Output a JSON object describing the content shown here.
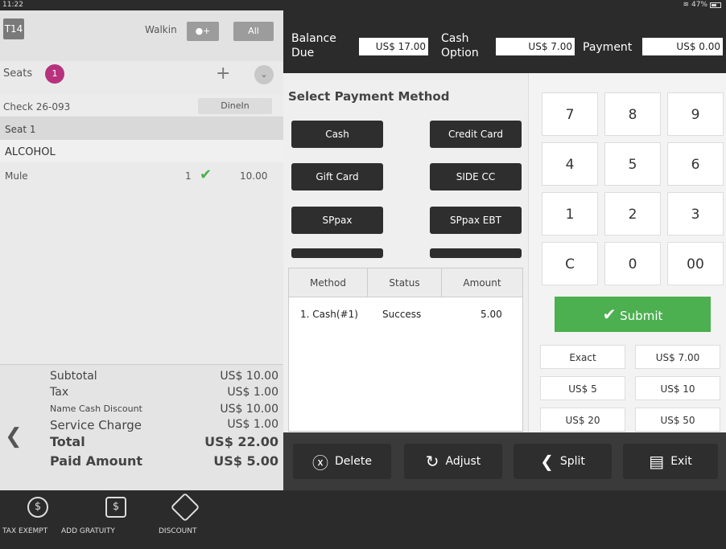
{
  "status_bar": {
    "time": "11:22",
    "battery": "47%"
  },
  "left": {
    "table": "T14",
    "walkin": "Walkin",
    "filter_all": "All",
    "seats_label": "Seats",
    "seats_count": "1",
    "check": "Check 26-093",
    "order_type": "DineIn",
    "seat": "Seat 1",
    "category": "ALCOHOL",
    "item": {
      "name": "Mule",
      "qty": "1",
      "price": "10.00"
    },
    "totals": [
      {
        "label": "Subtotal",
        "value": "US$ 10.00"
      },
      {
        "label": "Tax",
        "value": "US$ 1.00"
      },
      {
        "label": "Name Cash Discount",
        "value": "US$ 10.00"
      },
      {
        "label": "Service Charge",
        "value": "US$ 1.00"
      },
      {
        "label": "Total",
        "value": "US$ 22.00"
      },
      {
        "label": "Paid Amount",
        "value": "US$ 5.00"
      }
    ]
  },
  "bottom_bar": {
    "tax_exempt": "TAX EXEMPT",
    "add_gratuity": "ADD GRATUITY",
    "discount": "DISCOUNT"
  },
  "top": {
    "balance_due_label_1": "Balance",
    "balance_due_label_2": "Due",
    "balance_due": "US$ 17.00",
    "cash_option_label_1": "Cash",
    "cash_option_label_2": "Option",
    "cash_option": "US$ 7.00",
    "payment_label": "Payment",
    "payment": "US$ 0.00"
  },
  "payment_methods": {
    "title": "Select Payment Method",
    "buttons": [
      "Cash",
      "Credit Card",
      "Gift Card",
      "SIDE CC",
      "SPpax",
      "SPpax EBT"
    ],
    "table_headers": [
      "Method",
      "Status",
      "Amount"
    ],
    "rows": [
      {
        "method": "1. Cash(#1)",
        "status": "Success",
        "amount": "5.00"
      }
    ]
  },
  "keypad": {
    "keys": [
      "7",
      "8",
      "9",
      "4",
      "5",
      "6",
      "1",
      "2",
      "3",
      "C",
      "0",
      "00"
    ],
    "submit": "Submit",
    "quick_amounts": [
      "Exact",
      "US$ 7.00",
      "US$ 5",
      "US$ 10",
      "US$ 20",
      "US$ 50"
    ]
  },
  "actions": {
    "delete": "Delete",
    "adjust": "Adjust",
    "split": "Split",
    "exit": "Exit"
  }
}
